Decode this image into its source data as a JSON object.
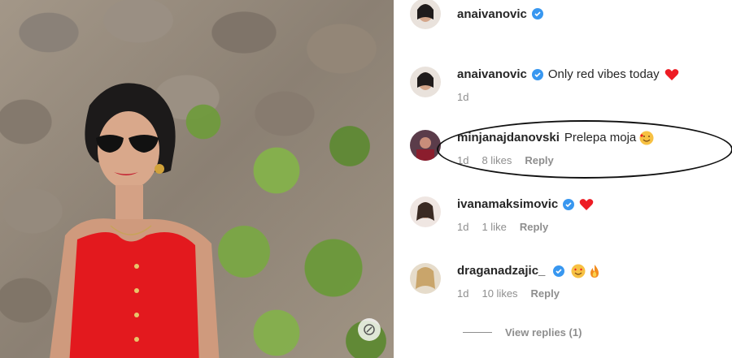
{
  "header": {
    "username": "anaivanovic"
  },
  "comments": [
    {
      "username": "anaivanovic",
      "text": "Only red vibes today",
      "time": "1d",
      "likes": "",
      "reply": "",
      "emoji": "heart"
    },
    {
      "username": "minjanajdanovski",
      "text": "Prelepa moja",
      "time": "1d",
      "likes": "8 likes",
      "reply": "Reply",
      "emoji": "smiling-face-with-hearts"
    },
    {
      "username": "ivanamaksimovic",
      "text": "",
      "time": "1d",
      "likes": "1 like",
      "reply": "Reply",
      "emoji": "heart"
    },
    {
      "username": "draganadzajic_",
      "text": "",
      "time": "1d",
      "likes": "10 likes",
      "reply": "Reply",
      "emoji": "heart-eyes-and-fire"
    }
  ],
  "view_replies": "View replies (1)",
  "colors": {
    "verified": "#3897f0",
    "heart": "#ed1c24",
    "dress": "#e3191e"
  }
}
